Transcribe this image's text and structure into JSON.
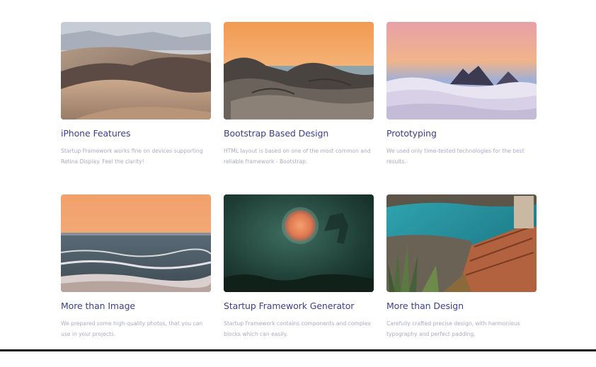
{
  "features": [
    {
      "image": "desert-dunes-photo",
      "title": "iPhone Features",
      "description": "Startup Framework works fine on devices supporting Retina Display. Feel the clarity!"
    },
    {
      "image": "rocky-shore-sunset-photo",
      "title": "Bootstrap Based Design",
      "description": "HTML layout is based on one of the most common and reliable framework - Bootstrap."
    },
    {
      "image": "mountain-peaks-above-clouds-photo",
      "title": "Prototyping",
      "description": "We used only time-tested technologies for the best results."
    },
    {
      "image": "ocean-waves-sunset-photo",
      "title": "More than Image",
      "description": "We prepared some high-quality photos, that you can use in your projects."
    },
    {
      "image": "green-misty-moon-photo",
      "title": "Startup Framework Generator",
      "description": "Startup Framework contains components and complex blocks which can easily."
    },
    {
      "image": "coastal-village-agave-photo",
      "title": "More than Design",
      "description": "Carefully crafted precise design, with harmonious typography and perfect padding."
    }
  ]
}
